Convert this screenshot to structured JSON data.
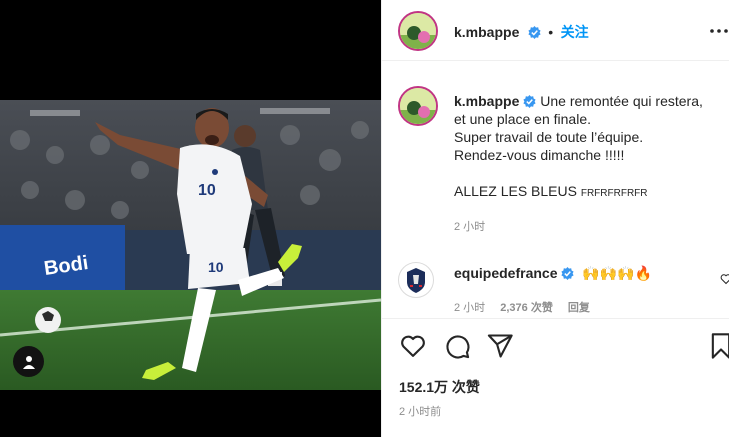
{
  "post": {
    "author": "k.mbappe",
    "follow_label": "关注",
    "more_icon": "more-horizontal-icon",
    "caption": {
      "line1": "Une remontée qui restera,",
      "line2": "et une place en finale.",
      "line3": "Super travail de toute l’équipe.",
      "line4": "Rendez-vous dimanche !!!!!",
      "line5_main": "ALLEZ LES BLEUS",
      "line5_tail": "FRFRFRFRFR",
      "time": "2 小时"
    },
    "comment": {
      "author": "equipedefrance",
      "text": "🙌🙌🙌🔥",
      "time": "2 小时",
      "likes": "2,376 次赞",
      "reply_label": "回复"
    },
    "actions": {
      "like_icon": "heart-icon",
      "comment_icon": "comment-icon",
      "share_icon": "share-icon",
      "save_icon": "bookmark-icon"
    },
    "likes_count": "152.1万 次赞",
    "posted_ago": "2 小时前"
  },
  "photo": {
    "jersey_number": "10"
  },
  "colors": {
    "accent": "#0095f6",
    "verified": "#3897f0",
    "muted": "#8e8e8e",
    "story_ring": "#c13584"
  }
}
